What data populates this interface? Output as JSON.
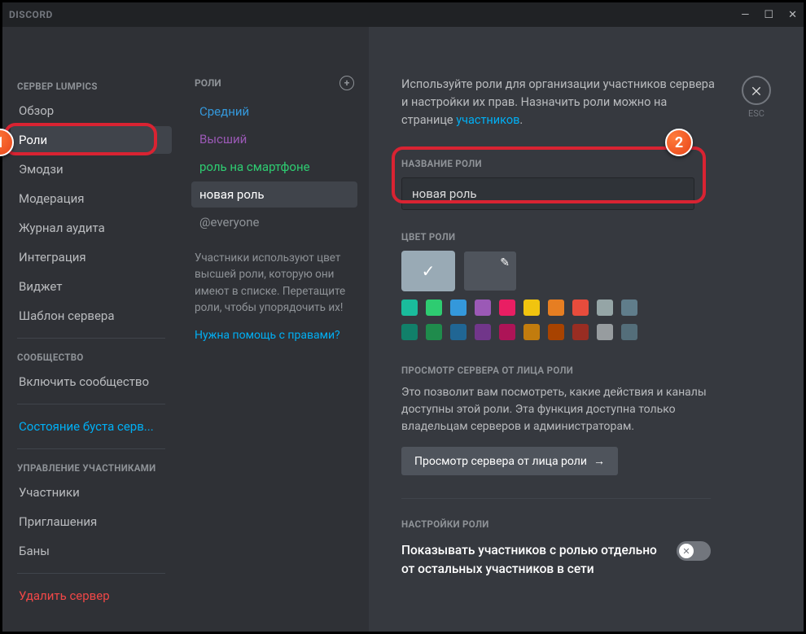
{
  "titlebar": {
    "app": "DISCORD"
  },
  "close": {
    "label": "ESC"
  },
  "sidebar": {
    "server_header": "СЕРВЕР LUMPICS",
    "items1": [
      "Обзор",
      "Роли",
      "Эмодзи",
      "Модерация",
      "Журнал аудита",
      "Интеграция",
      "Виджет",
      "Шаблон сервера"
    ],
    "community_header": "СООБЩЕСТВО",
    "community_item": "Включить сообщество",
    "boost_item": "Состояние буста серв...",
    "manage_header": "УПРАВЛЕНИЕ УЧАСТНИКАМИ",
    "items3": [
      "Участники",
      "Приглашения",
      "Баны"
    ],
    "delete": "Удалить сервер"
  },
  "roles": {
    "header": "РОЛИ",
    "list": [
      {
        "label": "Средний",
        "color": "#3498db"
      },
      {
        "label": "Высший",
        "color": "#9b59b6"
      },
      {
        "label": "роль на смартфоне",
        "color": "#2ecc71"
      },
      {
        "label": "новая роль",
        "color": "#ffffff",
        "selected": true
      },
      {
        "label": "@everyone",
        "color": "#8e9297"
      }
    ],
    "help": "Участники используют цвет высшей роли, которую они имеют в списке. Перетащите роли, чтобы упорядочить их!",
    "perms_link": "Нужна помощь с правами?"
  },
  "content": {
    "intro_pre": "Используйте роли для организации участников сервера и настройки их прав. Назначить роли можно на странице ",
    "intro_link": "участников",
    "intro_post": ".",
    "name_label": "НАЗВАНИЕ РОЛИ",
    "name_value": "новая роль",
    "color_label": "ЦВЕТ РОЛИ",
    "swatches_row1": [
      "#1abc9c",
      "#2ecc71",
      "#3498db",
      "#9b59b6",
      "#e91e63",
      "#f1c40f",
      "#e67e22",
      "#e74c3c",
      "#95a5a6",
      "#607d8b"
    ],
    "swatches_row2": [
      "#11806a",
      "#1f8b4c",
      "#206694",
      "#71368a",
      "#ad1457",
      "#c27c0e",
      "#a84300",
      "#992d22",
      "#979c9f",
      "#546e7a"
    ],
    "view_label": "ПРОСМОТР СЕРВЕРА ОТ ЛИЦА РОЛИ",
    "view_desc": "Это позволит вам посмотреть, какие действия и каналы доступны этой роли. Эта функция доступна только владельцам серверов и администраторам.",
    "view_button": "Просмотр сервера от лица роли",
    "settings_label": "НАСТРОЙКИ РОЛИ",
    "toggle_label": "Показывать участников с ролью отдельно от остальных участников в сети"
  },
  "callouts": {
    "one": "1",
    "two": "2"
  }
}
